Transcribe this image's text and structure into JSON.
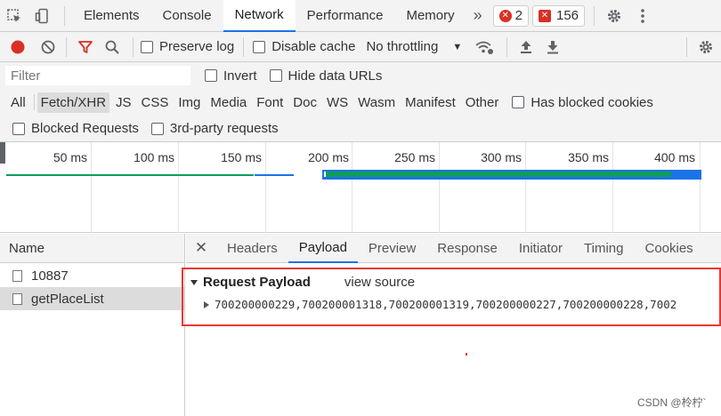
{
  "top_tabs": [
    "Elements",
    "Console",
    "Network",
    "Performance",
    "Memory"
  ],
  "active_tab": "Network",
  "more_tabs_label": "»",
  "errors": {
    "count": "2"
  },
  "issues": {
    "count": "156"
  },
  "toolbar": {
    "preserve_log": "Preserve log",
    "disable_cache": "Disable cache",
    "throttling": "No throttling"
  },
  "filter": {
    "placeholder": "Filter",
    "invert": "Invert",
    "hide_data_urls": "Hide data URLs"
  },
  "type_filters": [
    "All",
    "Fetch/XHR",
    "JS",
    "CSS",
    "Img",
    "Media",
    "Font",
    "Doc",
    "WS",
    "Wasm",
    "Manifest",
    "Other"
  ],
  "active_type": "Fetch/XHR",
  "has_blocked_cookies": "Has blocked cookies",
  "blocked_requests": "Blocked Requests",
  "third_party": "3rd-party requests",
  "timeline": {
    "ticks": [
      "50 ms",
      "100 ms",
      "150 ms",
      "200 ms",
      "250 ms",
      "300 ms",
      "350 ms",
      "400 ms"
    ],
    "colors": {
      "green": "#0f9d58",
      "blue": "#1a73e8"
    }
  },
  "request_list": {
    "header": "Name",
    "rows": [
      "10887",
      "getPlaceList"
    ],
    "selected": "getPlaceList"
  },
  "details": {
    "tabs": [
      "Headers",
      "Payload",
      "Preview",
      "Response",
      "Initiator",
      "Timing",
      "Cookies"
    ],
    "active": "Payload",
    "payload_title": "Request Payload",
    "view_source": "view source",
    "payload_value": "700200000229,700200001318,700200001319,700200000227,700200000228,7002"
  },
  "watermark": "CSDN @柃柠`"
}
